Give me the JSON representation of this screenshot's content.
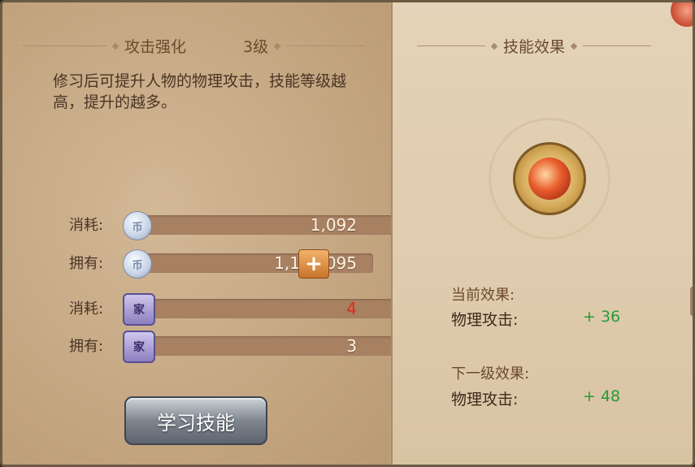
{
  "left_panel": {
    "skill_name": "攻击强化",
    "skill_level": "3级",
    "description": "修习后可提升人物的物理攻击，技能等级越高，提升的越多。",
    "rows": [
      {
        "label": "消耗:",
        "value": "1,092",
        "icon": "silver-coin-icon"
      },
      {
        "label": "拥有:",
        "value": "1,172,095",
        "icon": "silver-coin-icon"
      },
      {
        "label": "消耗:",
        "value": "4",
        "icon": "family-token-icon"
      },
      {
        "label": "拥有:",
        "value": "3",
        "icon": "family-token-icon"
      }
    ],
    "coin_glyph": "币",
    "token_glyph": "家",
    "add_label": "+",
    "learn_button": "学习技能"
  },
  "right_panel": {
    "title": "技能效果",
    "current_title": "当前效果:",
    "current_name": "物理攻击:",
    "current_value": "+ 36",
    "next_title": "下一级效果:",
    "next_name": "物理攻击:",
    "next_value": "+ 48"
  },
  "colors": {
    "insufficient": "#e02a1a",
    "bonus": "#2a9a3a",
    "button_accent": "#c9742c"
  }
}
